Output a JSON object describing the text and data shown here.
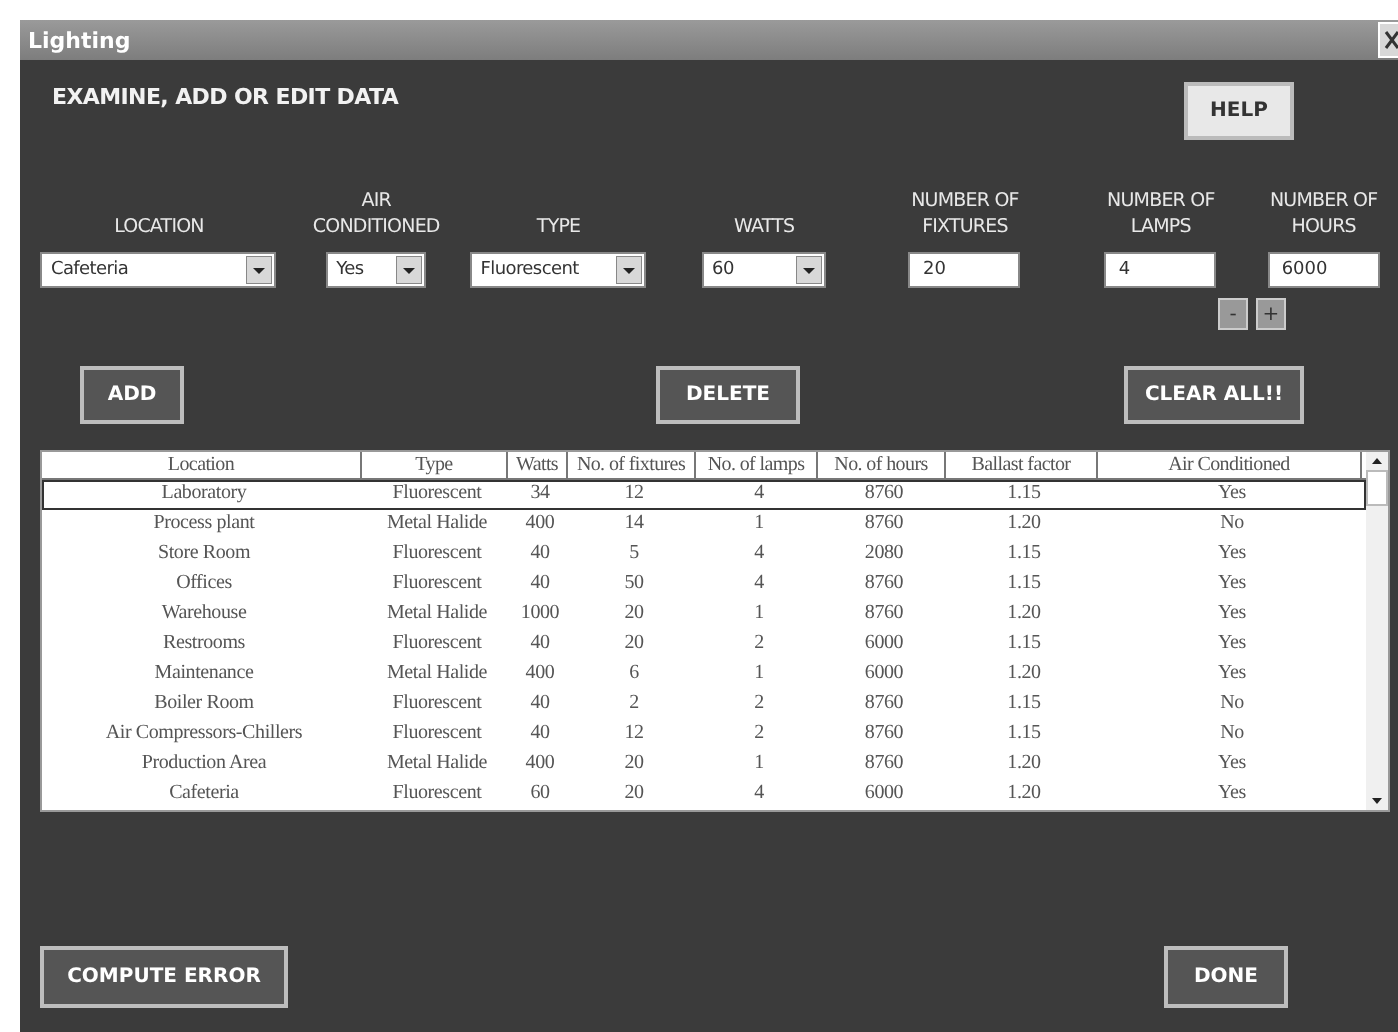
{
  "window": {
    "title": "Lighting"
  },
  "heading": "EXAMINE, ADD OR EDIT DATA",
  "help_button": "HELP",
  "fields": [
    {
      "kind": "dropdown",
      "label": "LOCATION",
      "value": "Cafeteria"
    },
    {
      "kind": "dropdown",
      "label": "AIR CONDITIONED",
      "value": "Yes"
    },
    {
      "kind": "dropdown",
      "label": "TYPE",
      "value": "Fluorescent"
    },
    {
      "kind": "dropdown",
      "label": "WATTS",
      "value": "60"
    },
    {
      "kind": "text",
      "label": "NUMBER OF FIXTURES",
      "value": "20"
    },
    {
      "kind": "text",
      "label": "NUMBER OF LAMPS",
      "value": "4"
    },
    {
      "kind": "text",
      "label": "NUMBER OF HOURS",
      "value": "6000"
    }
  ],
  "spin_buttons": [
    "-",
    "+"
  ],
  "action_buttons": [
    "ADD",
    "DELETE",
    "CLEAR ALL!!"
  ],
  "table": {
    "columns": [
      "Location",
      "Type",
      "Watts",
      "No. of fixtures",
      "No. of lamps",
      "No. of hours",
      "Ballast factor",
      "Air Conditioned"
    ],
    "rows": [
      {
        "selected": true,
        "cells": [
          "Laboratory",
          "Fluorescent",
          "34",
          "12",
          "4",
          "8760",
          "1.15",
          "Yes"
        ]
      },
      {
        "selected": false,
        "cells": [
          "Process plant",
          "Metal Halide",
          "400",
          "14",
          "1",
          "8760",
          "1.20",
          "No"
        ]
      },
      {
        "selected": false,
        "cells": [
          "Store Room",
          "Fluorescent",
          "40",
          "5",
          "4",
          "2080",
          "1.15",
          "Yes"
        ]
      },
      {
        "selected": false,
        "cells": [
          "Offices",
          "Fluorescent",
          "40",
          "50",
          "4",
          "8760",
          "1.15",
          "Yes"
        ]
      },
      {
        "selected": false,
        "cells": [
          "Warehouse",
          "Metal Halide",
          "1000",
          "20",
          "1",
          "8760",
          "1.20",
          "Yes"
        ]
      },
      {
        "selected": false,
        "cells": [
          "Restrooms",
          "Fluorescent",
          "40",
          "20",
          "2",
          "6000",
          "1.15",
          "Yes"
        ]
      },
      {
        "selected": false,
        "cells": [
          "Maintenance",
          "Metal Halide",
          "400",
          "6",
          "1",
          "6000",
          "1.20",
          "Yes"
        ]
      },
      {
        "selected": false,
        "cells": [
          "Boiler Room",
          "Fluorescent",
          "40",
          "2",
          "2",
          "8760",
          "1.15",
          "No"
        ]
      },
      {
        "selected": false,
        "cells": [
          "Air Compressors-Chillers",
          "Fluorescent",
          "40",
          "12",
          "2",
          "8760",
          "1.15",
          "No"
        ]
      },
      {
        "selected": false,
        "cells": [
          "Production Area",
          "Metal Halide",
          "400",
          "20",
          "1",
          "8760",
          "1.20",
          "Yes"
        ]
      },
      {
        "selected": false,
        "cells": [
          "Cafeteria",
          "Fluorescent",
          "60",
          "20",
          "4",
          "6000",
          "1.20",
          "Yes"
        ]
      }
    ]
  },
  "footer_buttons": [
    "COMPUTE ERROR",
    "DONE"
  ]
}
